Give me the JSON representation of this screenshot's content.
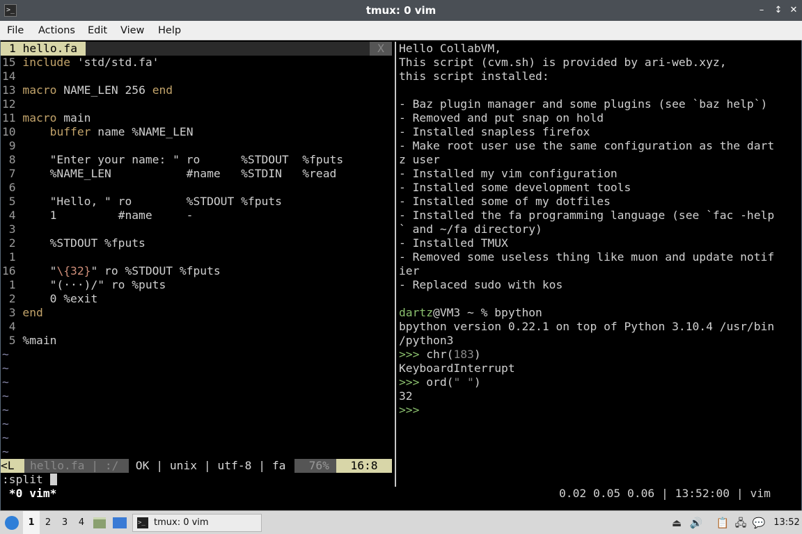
{
  "window": {
    "title": "tmux: 0 vim",
    "app_icon": "terminal-icon",
    "controls": [
      "minimize-icon",
      "restore-icon",
      "maximize-icon",
      "close-icon"
    ]
  },
  "menubar": {
    "items": [
      "File",
      "Actions",
      "Edit",
      "View",
      "Help"
    ]
  },
  "vim": {
    "tab": "1 hello.fa",
    "tab_close": "X",
    "code_lines": [
      {
        "num": "15",
        "segs": [
          {
            "t": "include ",
            "c": "kw"
          },
          {
            "t": "'std/std.fa'",
            "c": "str"
          }
        ]
      },
      {
        "num": "14",
        "segs": []
      },
      {
        "num": "13",
        "segs": [
          {
            "t": "macro ",
            "c": "kw"
          },
          {
            "t": "NAME_LEN 256 ",
            "c": ""
          },
          {
            "t": "end",
            "c": "kw"
          }
        ]
      },
      {
        "num": "12",
        "segs": []
      },
      {
        "num": "11",
        "segs": [
          {
            "t": "macro ",
            "c": "kw"
          },
          {
            "t": "main",
            "c": ""
          }
        ]
      },
      {
        "num": "10",
        "segs": [
          {
            "t": "    ",
            "c": ""
          },
          {
            "t": "buffer ",
            "c": "kw"
          },
          {
            "t": "name %NAME_LEN",
            "c": ""
          }
        ]
      },
      {
        "num": " 9",
        "segs": []
      },
      {
        "num": " 8",
        "segs": [
          {
            "t": "    \"Enter your name: \" ro      %STDOUT  %fputs",
            "c": ""
          }
        ]
      },
      {
        "num": " 7",
        "segs": [
          {
            "t": "    %NAME_LEN           #name   %STDIN   %read",
            "c": ""
          }
        ]
      },
      {
        "num": " 6",
        "segs": []
      },
      {
        "num": " 5",
        "segs": [
          {
            "t": "    \"Hello, \" ro        %STDOUT %fputs",
            "c": ""
          }
        ]
      },
      {
        "num": " 4",
        "segs": [
          {
            "t": "    1         #name     -",
            "c": ""
          }
        ]
      },
      {
        "num": " 3",
        "segs": []
      },
      {
        "num": " 2",
        "segs": [
          {
            "t": "    %STDOUT %fputs",
            "c": ""
          }
        ]
      },
      {
        "num": " 1",
        "segs": []
      },
      {
        "num": "16 ",
        "segs": [
          {
            "t": "    \"",
            "c": ""
          },
          {
            "t": "\\{32}",
            "c": "esc"
          },
          {
            "t": "\" ro %STDOUT %fputs",
            "c": ""
          }
        ]
      },
      {
        "num": " 1",
        "segs": [
          {
            "t": "    \"(···)/\" ro %puts",
            "c": ""
          }
        ]
      },
      {
        "num": " 2",
        "segs": [
          {
            "t": "    0 %exit",
            "c": ""
          }
        ]
      },
      {
        "num": " 3",
        "segs": [
          {
            "t": "end",
            "c": "kw"
          }
        ]
      },
      {
        "num": " 4",
        "segs": []
      },
      {
        "num": " 5",
        "segs": [
          {
            "t": "%main",
            "c": ""
          }
        ]
      }
    ],
    "tilde_count": 8,
    "status": {
      "mode": "<L",
      "file": "hello.fa | :/",
      "info": " OK | unix | utf-8 | fa",
      "percent": "76%",
      "position": "16:8"
    },
    "cmdline": ":split "
  },
  "shell": {
    "lines": [
      "Hello CollabVM,",
      "This script (cvm.sh) is provided by ari-web.xyz,",
      "this script installed:",
      "",
      "- Baz plugin manager and some plugins (see `baz help`)",
      "- Removed and put snap on hold",
      "- Installed snapless firefox",
      "- Make root user use the same configuration as the dart",
      "z user",
      "- Installed my vim configuration",
      "- Installed some development tools",
      "- Installed some of my dotfiles",
      "- Installed the fa programming language (see `fac -help",
      "` and ~/fa directory)",
      "- Installed TMUX",
      "- Removed some useless thing like muon and update notif",
      "ier",
      "- Replaced sudo with kos",
      ""
    ],
    "prompt_user": "dartz",
    "prompt_rest": "@VM3 ~ % bpython",
    "bpython_lines": [
      "bpython version 0.22.1 on top of Python 3.10.4 /usr/bin",
      "/python3"
    ],
    "repl": {
      "prompt": ">>>",
      "cmd1_name": " chr(",
      "cmd1_arg": "183",
      "cmd1_close": ")",
      "out1": "KeyboardInterrupt",
      "cmd2_name": " ord(",
      "cmd2_arg": "\" \"",
      "cmd2_close": ")",
      "out2": "32"
    }
  },
  "tmux": {
    "window_label": " *0 vim*",
    "right_status": "0.02 0.05 0.06 | 13:52:00 | vim"
  },
  "taskbar": {
    "workspaces": [
      "1",
      "2",
      "3",
      "4"
    ],
    "active_workspace": "1",
    "task_label": "tmux: 0 vim",
    "clock": "13:52",
    "tray_icons": [
      "eject-icon",
      "volume-icon",
      "clipboard-icon",
      "network-icon",
      "notification-icon"
    ]
  },
  "colors": {
    "accent_tab": "#d8d6a8",
    "prompt_user": "#8bc06e",
    "keyword": "#c3a46b"
  }
}
